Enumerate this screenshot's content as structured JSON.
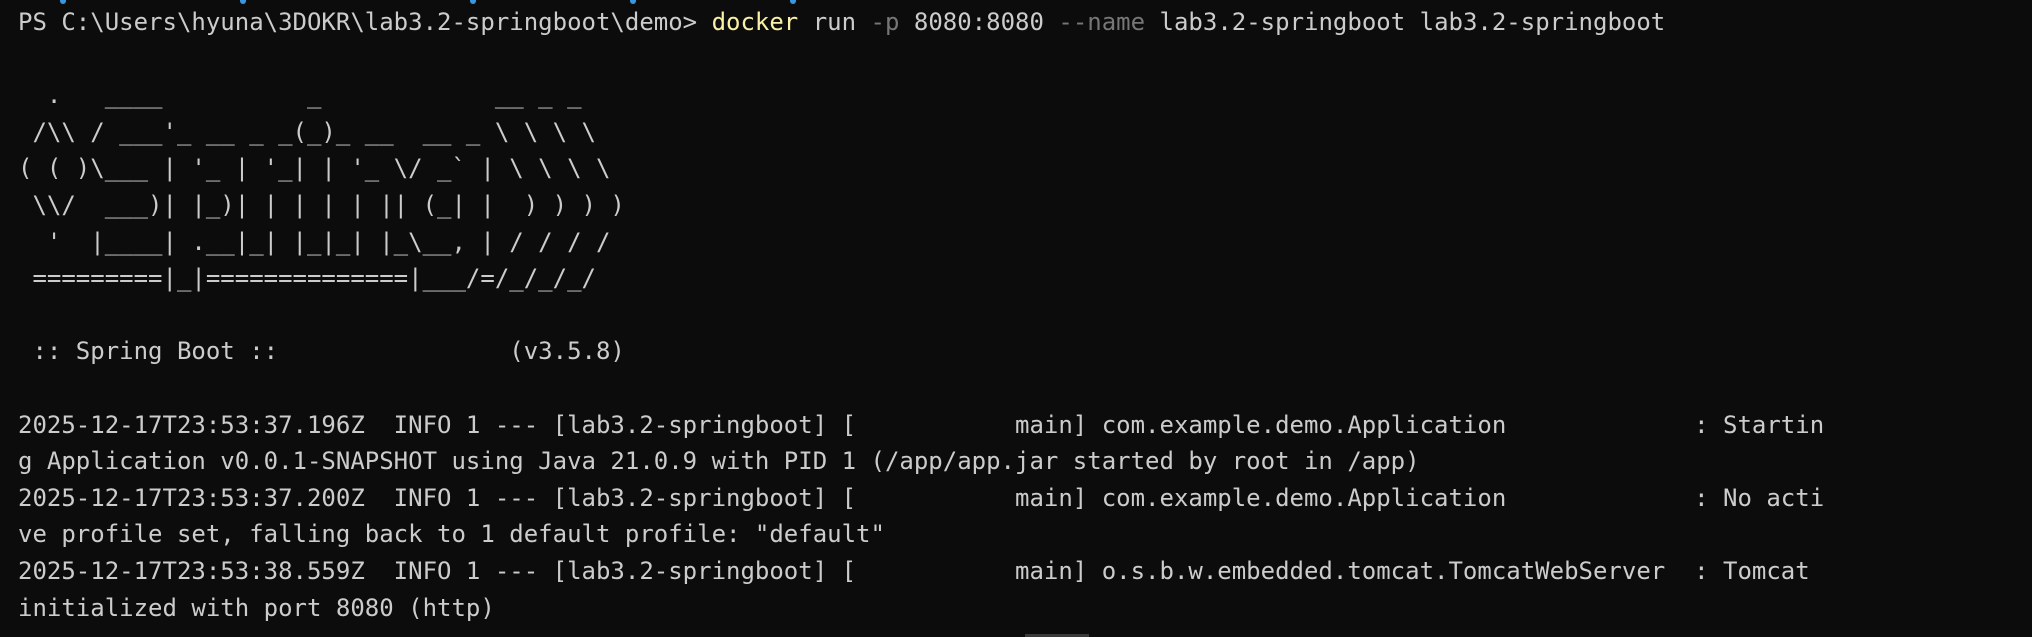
{
  "terminal": {
    "prompt": "PS C:\\Users\\hyuna\\3DOKR\\lab3.2-springboot\\demo> ",
    "command": {
      "exe": "docker",
      "sub": " run ",
      "flag_p": "-p",
      "port": " 8080:8080 ",
      "flag_name": "--name",
      "rest": " lab3.2-springboot lab3.2-springboot"
    },
    "banner": [
      "  .   ____          _            __ _ _",
      " /\\\\ / ___'_ __ _ _(_)_ __  __ _ \\ \\ \\ \\",
      "( ( )\\___ | '_ | '_| | '_ \\/ _` | \\ \\ \\ \\",
      " \\\\/  ___)| |_)| | | | | || (_| |  ) ) ) )",
      "  '  |____| .__|_| |_|_| |_\\__, | / / / /",
      " =========|_|==============|___/=/_/_/_/"
    ],
    "version_line": " :: Spring Boot ::                (v3.5.8)",
    "log_lines": [
      "2025-12-17T23:53:37.196Z  INFO 1 --- [lab3.2-springboot] [           main] com.example.demo.Application             : Startin",
      "g Application v0.0.1-SNAPSHOT using Java 21.0.9 with PID 1 (/app/app.jar started by root in /app)",
      "2025-12-17T23:53:37.200Z  INFO 1 --- [lab3.2-springboot] [           main] com.example.demo.Application             : No acti",
      "ve profile set, falling back to 1 default profile: \"default\"",
      "2025-12-17T23:53:38.559Z  INFO 1 --- [lab3.2-springboot] [           main] o.s.b.w.embedded.tomcat.TomcatWebServer  : Tomcat",
      "initialized with port 8080 (http)"
    ]
  },
  "colors": {
    "background": "#0c0c0c",
    "foreground": "#cccccc",
    "command": "#f9f1a5",
    "flag": "#767676"
  }
}
